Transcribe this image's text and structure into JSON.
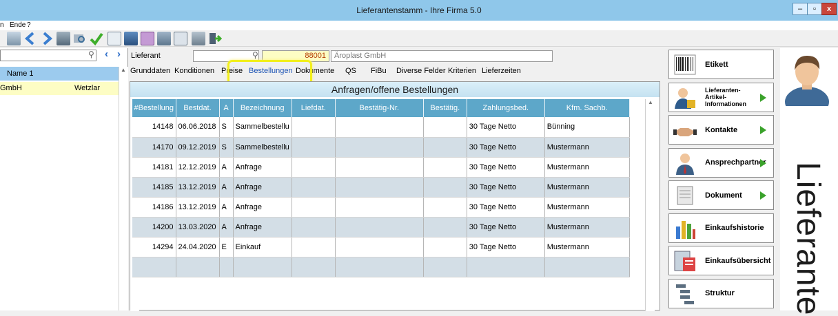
{
  "window": {
    "title": "Lieferantenstamm - Ihre Firma 5.0",
    "controls": {
      "minimize": "–",
      "maximize": "▫",
      "close": "x"
    }
  },
  "menu": [
    "n",
    "Ende",
    "?"
  ],
  "toolbar_icons": [
    "save-icon",
    "back-arrow-icon",
    "forward-arrow-icon",
    "database-icon",
    "search-magnifier-icon",
    "checkmark-icon",
    "document-copy-icon",
    "chart-icon",
    "table-icon",
    "notes-icon",
    "clipboard-icon",
    "paste-icon",
    "exit-icon"
  ],
  "left_panel": {
    "columns": [
      "Name 1",
      ""
    ],
    "rows": [
      {
        "name": "GmbH",
        "city": "Wetzlar"
      }
    ]
  },
  "supplier": {
    "label": "Lieferant",
    "number": "88001",
    "name": "Äroplast GmbH"
  },
  "tabs": {
    "items": [
      "Grunddaten",
      "Konditionen",
      "Preise",
      "Bestellungen",
      "Dokumente",
      "QS",
      "FiBu",
      "Diverse Felder",
      "Kriterien",
      "Lieferzeiten"
    ],
    "active": "Bestellungen"
  },
  "section_title": "Anfragen/offene Bestellungen",
  "table": {
    "columns": [
      "#Bestellung",
      "Bestdat.",
      "A",
      "Bezeichnung",
      "Liefdat.",
      "Bestätig-Nr.",
      "Bestätig.",
      "Zahlungsbed.",
      "Kfm. Sachb."
    ],
    "rows": [
      [
        "14148",
        "06.06.2018",
        "S",
        "Sammelbestellu",
        "",
        "",
        "",
        "30 Tage Netto",
        "Bünning"
      ],
      [
        "14170",
        "09.12.2019",
        "S",
        "Sammelbestellu",
        "",
        "",
        "",
        "30 Tage Netto",
        "Mustermann"
      ],
      [
        "14181",
        "12.12.2019",
        "A",
        "Anfrage",
        "",
        "",
        "",
        "30 Tage Netto",
        "Mustermann"
      ],
      [
        "14185",
        "13.12.2019",
        "A",
        "Anfrage",
        "",
        "",
        "",
        "30 Tage Netto",
        "Mustermann"
      ],
      [
        "14186",
        "13.12.2019",
        "A",
        "Anfrage",
        "",
        "",
        "",
        "30 Tage Netto",
        "Mustermann"
      ],
      [
        "14200",
        "13.03.2020",
        "A",
        "Anfrage",
        "",
        "",
        "",
        "30 Tage Netto",
        "Mustermann"
      ],
      [
        "14294",
        "24.04.2020",
        "E",
        "Einkauf",
        "",
        "",
        "",
        "30 Tage Netto",
        "Mustermann"
      ],
      [
        "",
        "",
        "",
        "",
        "",
        "",
        "",
        "",
        ""
      ]
    ]
  },
  "side_buttons": [
    {
      "label": "Etikett",
      "icon": "barcode-icon",
      "arrow": false
    },
    {
      "label": "Lieferanten-Artikel-Informationen",
      "icon": "person-puzzle-icon",
      "arrow": true
    },
    {
      "label": "Kontakte",
      "icon": "handshake-icon",
      "arrow": true
    },
    {
      "label": "Ansprechpartner",
      "icon": "businessman-icon",
      "arrow": true
    },
    {
      "label": "Dokument",
      "icon": "scroll-icon",
      "arrow": true
    },
    {
      "label": "Einkaufshistorie",
      "icon": "bar-chart-icon",
      "arrow": false
    },
    {
      "label": "Einkaufsübersicht",
      "icon": "report-icon",
      "arrow": false
    },
    {
      "label": "Struktur",
      "icon": "structure-icon",
      "arrow": false
    }
  ],
  "vertical_title": "Lieferante",
  "colors": {
    "titlebar": "#8fc7ea",
    "grid_header": "#5da7c9",
    "alt_row": "#d3dee6",
    "highlight": "#f2ef1b",
    "selection_row": "#fdfdc4",
    "supplier_number_field": "#fdfdc4"
  }
}
